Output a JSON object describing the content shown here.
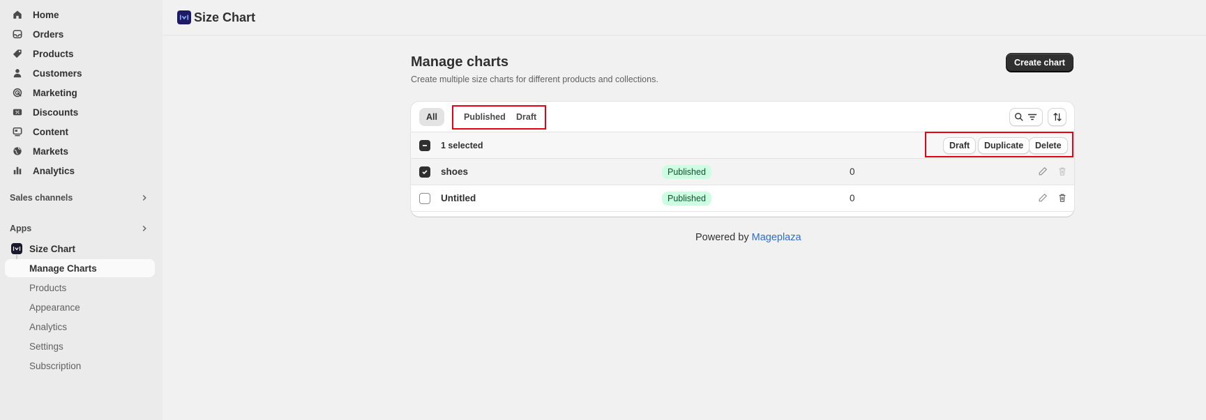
{
  "sidebar": {
    "nav": [
      {
        "label": "Home",
        "icon": "home-icon"
      },
      {
        "label": "Orders",
        "icon": "inbox-icon"
      },
      {
        "label": "Products",
        "icon": "tag-icon"
      },
      {
        "label": "Customers",
        "icon": "person-icon"
      },
      {
        "label": "Marketing",
        "icon": "target-icon"
      },
      {
        "label": "Discounts",
        "icon": "discount-icon"
      },
      {
        "label": "Content",
        "icon": "content-icon"
      },
      {
        "label": "Markets",
        "icon": "globe-icon"
      },
      {
        "label": "Analytics",
        "icon": "bar-chart-icon"
      }
    ],
    "sales_channels": "Sales channels",
    "apps": "Apps",
    "app_name": "Size Chart",
    "app_items": [
      "Manage Charts",
      "Products",
      "Appearance",
      "Analytics",
      "Settings",
      "Subscription"
    ]
  },
  "topbar": {
    "title": "Size Chart"
  },
  "page": {
    "title": "Manage charts",
    "subtitle": "Create multiple size charts for different products and collections.",
    "create_button": "Create chart"
  },
  "tabs": [
    "All",
    "Published",
    "Draft"
  ],
  "bulk": {
    "selected_text": "1 selected",
    "actions": [
      "Draft",
      "Duplicate",
      "Delete"
    ]
  },
  "rows": [
    {
      "name": "shoes",
      "status": "Published",
      "count": "0",
      "checked": true
    },
    {
      "name": "Untitled",
      "status": "Published",
      "count": "0",
      "checked": false
    }
  ],
  "footer": {
    "powered_by": "Powered by",
    "link": "Mageplaza"
  },
  "colors": {
    "highlight": "#e60012",
    "badge_bg": "#cdfee1",
    "badge_text": "#0c5132",
    "link": "#2c6ecb"
  }
}
